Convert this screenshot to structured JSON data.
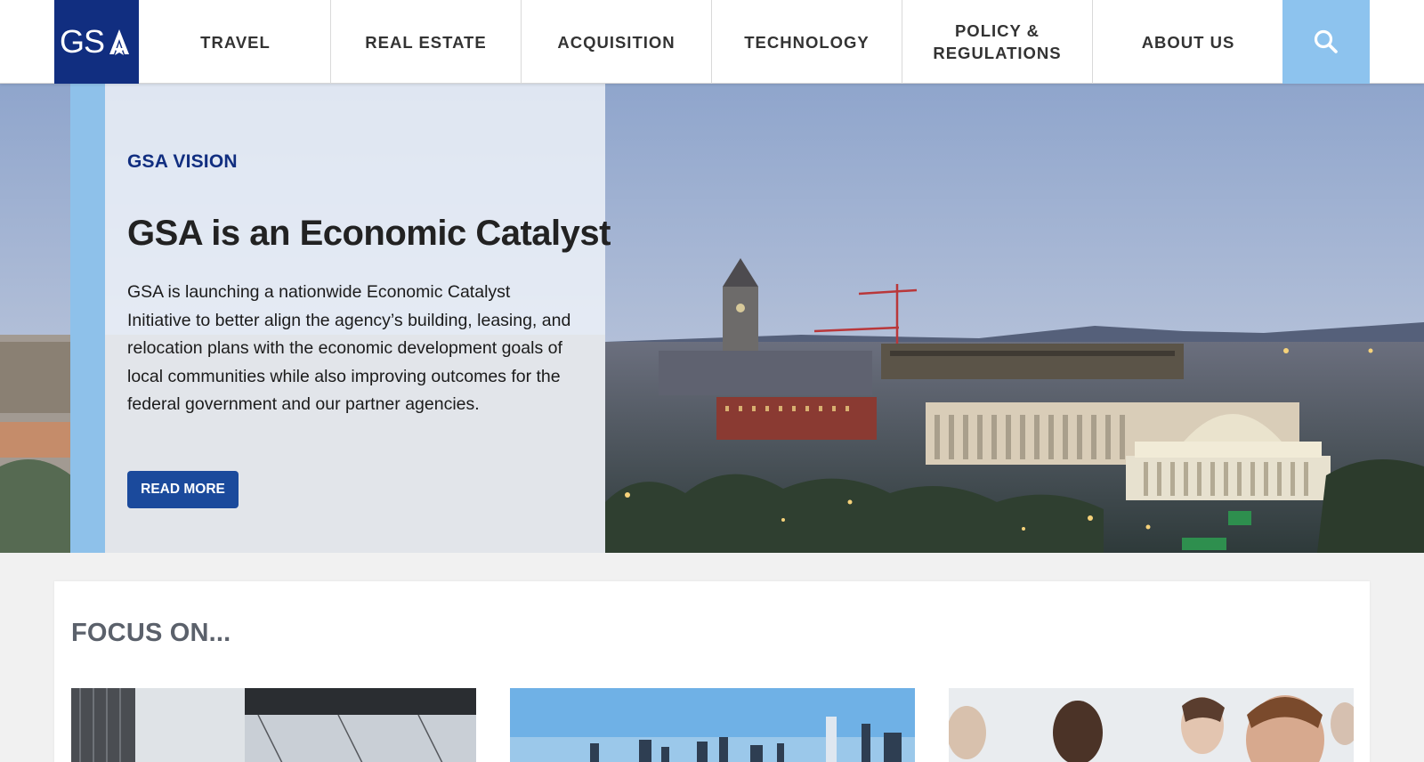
{
  "header": {
    "logo_text": "GSA",
    "nav": [
      {
        "label": "TRAVEL"
      },
      {
        "label": "REAL ESTATE"
      },
      {
        "label": "ACQUISITION"
      },
      {
        "label": "TECHNOLOGY"
      },
      {
        "label": "POLICY &\nREGULATIONS"
      },
      {
        "label": "ABOUT US"
      }
    ],
    "search_icon": "search-icon"
  },
  "hero": {
    "eyebrow": "GSA VISION",
    "title": "GSA is an Economic Catalyst",
    "body": "GSA is launching a nationwide Economic Catalyst Initiative to better align the agency’s building, leasing, and relocation plans with the economic development goals of local communities while also improving outcomes for the federal government and our partner agencies.",
    "button_label": "READ MORE"
  },
  "focus": {
    "title": "FOCUS ON..."
  },
  "colors": {
    "brand_navy": "#112e80",
    "accent_light_blue": "#8dc3ee",
    "button_blue": "#1b4a9c"
  }
}
